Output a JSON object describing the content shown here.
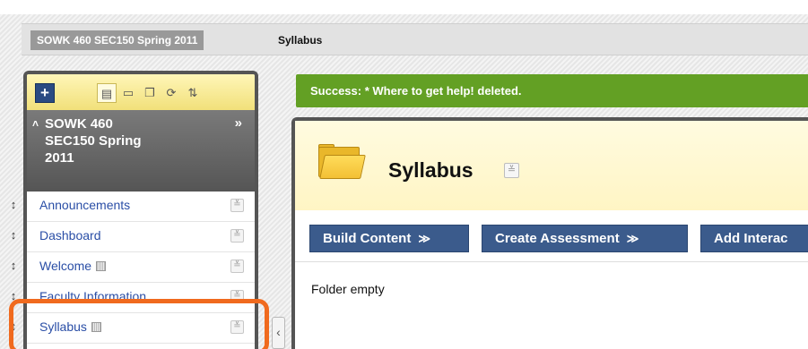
{
  "breadcrumb": {
    "course": "SOWK 460 SEC150 Spring 2011",
    "page": "Syllabus"
  },
  "toolbar": {
    "add_icon": "plus-icon",
    "tools": [
      "list-view-icon",
      "folder-view-icon",
      "window-icon",
      "refresh-icon",
      "sort-icon"
    ]
  },
  "course_menu": {
    "title_line1": "SOWK 460",
    "title_line2": "SEC150 Spring",
    "title_line3": "2011",
    "expand_glyph": "»",
    "collapse_glyph": "˄",
    "items": [
      {
        "label": "Announcements",
        "hidden": false
      },
      {
        "label": "Dashboard",
        "hidden": false
      },
      {
        "label": "Welcome",
        "hidden": true
      },
      {
        "label": "Faculty Information",
        "hidden": false
      },
      {
        "label": "Syllabus",
        "hidden": true
      }
    ]
  },
  "success_message": "Success: * Where to get help! deleted.",
  "page": {
    "title": "Syllabus",
    "empty_text": "Folder empty"
  },
  "actions": [
    {
      "label": "Build Content"
    },
    {
      "label": "Create Assessment"
    },
    {
      "label": "Add Interac"
    }
  ],
  "colors": {
    "success": "#63a024",
    "action_button": "#3b5b8c",
    "highlight": "#f06a1e",
    "link": "#2a4ea6"
  }
}
